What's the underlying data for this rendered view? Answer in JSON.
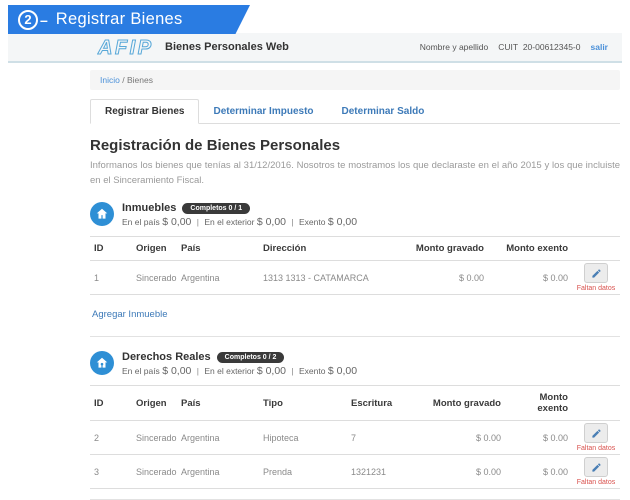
{
  "ui": {
    "separator": "|",
    "breadcrumb_separator": "/"
  },
  "banner": {
    "step": "2",
    "dash": "–",
    "title": "Registrar Bienes"
  },
  "header": {
    "logo_text": "AFIP",
    "app_title": "Bienes Personales Web",
    "user_name": "Nombre y apellido",
    "cuit_label": "CUIT",
    "cuit_value": "20-00612345-0",
    "logout_label": "salir"
  },
  "breadcrumb": {
    "home": "Inicio",
    "current": "Bienes"
  },
  "tabs": [
    {
      "label": "Registrar Bienes"
    },
    {
      "label": "Determinar Impuesto"
    },
    {
      "label": "Determinar Saldo"
    }
  ],
  "main": {
    "title": "Registración de Bienes Personales",
    "intro": "Informanos los bienes que tenías al 31/12/2016. Nosotros te mostramos los que declaraste en el año 2015 y los que incluiste en el Sinceramiento Fiscal."
  },
  "sections": [
    {
      "name": "Inmuebles",
      "badge": "Completos 0 / 1",
      "totals": [
        {
          "label": "En el país",
          "amount": "$ 0,00"
        },
        {
          "label": "En el exterior",
          "amount": "$ 0,00"
        },
        {
          "label": "Exento",
          "amount": "$ 0,00"
        }
      ],
      "columns": [
        "ID",
        "Origen",
        "País",
        "Dirección",
        "Monto gravado",
        "Monto exento"
      ],
      "rows": [
        {
          "id": "1",
          "origen": "Sincerado",
          "pais": "Argentina",
          "direccion": "1313 1313 - CATAMARCA",
          "gravado": "$ 0.00",
          "exento": "$ 0.00",
          "warning": "Faltan datos"
        }
      ],
      "add_link": "Agregar Inmueble"
    },
    {
      "name": "Derechos Reales",
      "badge": "Completos 0 / 2",
      "totals": [
        {
          "label": "En el país",
          "amount": "$ 0,00"
        },
        {
          "label": "En el exterior",
          "amount": "$ 0,00"
        },
        {
          "label": "Exento",
          "amount": "$ 0,00"
        }
      ],
      "columns": [
        "ID",
        "Origen",
        "País",
        "Tipo",
        "Escritura",
        "Monto gravado",
        "Monto exento"
      ],
      "rows": [
        {
          "id": "2",
          "origen": "Sincerado",
          "pais": "Argentina",
          "tipo": "Hipoteca",
          "escritura": "7",
          "gravado": "$ 0.00",
          "exento": "$ 0.00",
          "warning": "Faltan datos"
        },
        {
          "id": "3",
          "origen": "Sincerado",
          "pais": "Argentina",
          "tipo": "Prenda",
          "escritura": "1321231",
          "gravado": "$ 0.00",
          "exento": "$ 0.00",
          "warning": "Faltan datos"
        }
      ]
    }
  ]
}
